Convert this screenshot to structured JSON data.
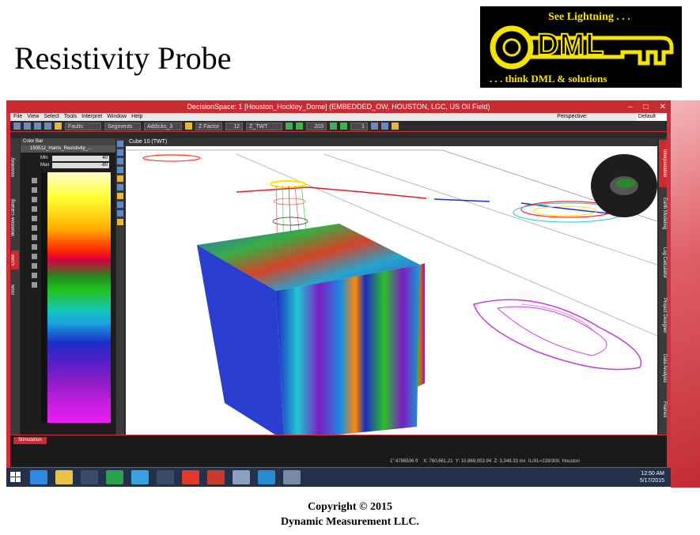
{
  "slide": {
    "title": "Resistivity Probe",
    "logo": {
      "tagline_top": "See Lightning . . .",
      "wordmark": "DML",
      "tagline_bottom": ". . . think DML & solutions",
      "colors": {
        "background": "#000000",
        "accent": "#f5e400"
      }
    },
    "copyright_line1": "Copyright  © 2015",
    "copyright_line2": "Dynamic  Measurement LLC."
  },
  "window": {
    "title": "DecisionSpace: 1 [Houston_Hockley_Dome] (EMBEDDED_OW, HOUSTON, LGC, US Oil Field)",
    "controls": [
      "–",
      "□",
      "✕"
    ],
    "accent_color": "#c92b33"
  },
  "menu": {
    "items": [
      "File",
      "View",
      "Select",
      "Tools",
      "Interpret",
      "Window",
      "Help"
    ],
    "perspective_label": "Perspective:",
    "perspective_value": "Default"
  },
  "toolbar": {
    "faults": "Faults",
    "segments": "Segments",
    "addicks": "Addicks_3",
    "zfactor_label": "Z Factor",
    "zfactor_value": "12",
    "domain": "Z_TWT",
    "frame_value": "203",
    "step_value": "1"
  },
  "left_tabs": [
    "Inventory",
    "Workflow Catalog",
    "Color",
    "Tools"
  ],
  "colorbar": {
    "header": "Color Bar",
    "file": "150512_Harris_Resistivity_...",
    "min_label": "Min",
    "min_value": "40",
    "max_label": "Max",
    "max_value": "-80"
  },
  "viewport": {
    "title": "Cube 10 (TWT)"
  },
  "right_tabs": [
    "Interpretation",
    "Earth Modeling",
    "Log Calculator",
    "Project Designer",
    "Data Analysis",
    "Frames"
  ],
  "status": {
    "tab": "Stimulation",
    "scale": "1\":4786536 ft",
    "x_label": "X:",
    "x_value": "760,661.21",
    "y_label": "Y:",
    "y_value": "10,869,053.94",
    "z_label": "Z:",
    "z_value": "3,348.33 ms",
    "il_xl": "IL/XL=228/300, Houston"
  },
  "taskbar": {
    "time": "12:50 AM",
    "date": "5/17/2015"
  }
}
